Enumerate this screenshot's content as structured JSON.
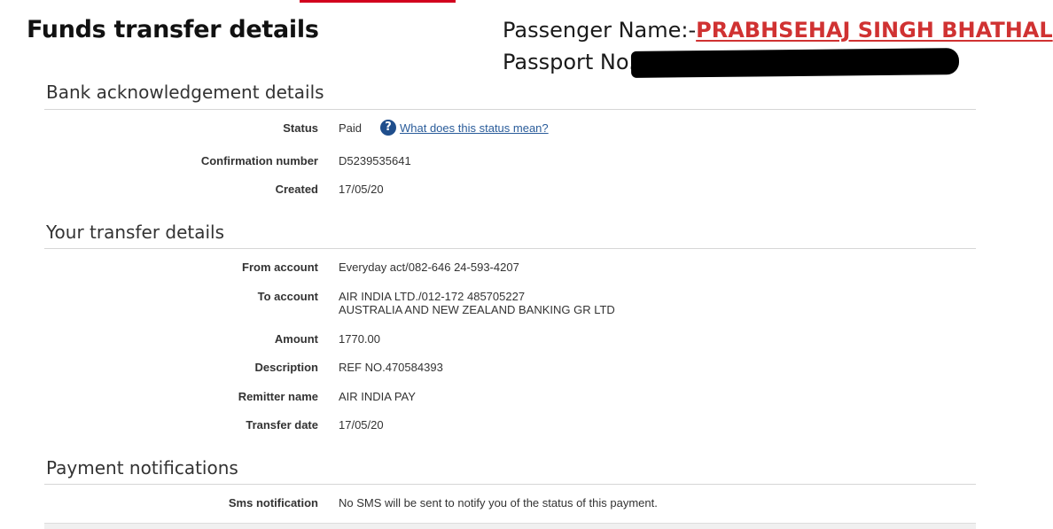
{
  "header": {
    "title": "Funds transfer details",
    "passenger_label": "Passenger Name:-",
    "passenger_name": "PRABHSEHAJ SINGH BHATHAL",
    "passport_label": "Passport No."
  },
  "bank_acknowledgement": {
    "heading": "Bank acknowledgement details",
    "status_label": "Status",
    "status_value": "Paid",
    "status_help_link": "What does this status mean?",
    "confirmation_label": "Confirmation number",
    "confirmation_value": "D5239535641",
    "created_label": "Created",
    "created_value": "17/05/20"
  },
  "transfer_details": {
    "heading": "Your transfer details",
    "from_label": "From account",
    "from_value": "Everyday act/082-646 24-593-4207",
    "to_label": "To account",
    "to_value_line1": "AIR INDIA LTD./012-172 485705227",
    "to_value_line2": "AUSTRALIA AND NEW ZEALAND BANKING GR LTD",
    "amount_label": "Amount",
    "amount_value": "1770.00",
    "description_label": "Description",
    "description_value": "REF NO.470584393",
    "remitter_label": "Remitter name",
    "remitter_value": "AIR INDIA PAY",
    "transfer_date_label": "Transfer date",
    "transfer_date_value": "17/05/20"
  },
  "payment_notifications": {
    "heading": "Payment notifications",
    "sms_label": "Sms notification",
    "sms_value": "No SMS will be sent to notify you of the status of this payment."
  },
  "colors": {
    "accent": "#d2001e",
    "passenger_name": "#d03232",
    "link": "#2a5c9a",
    "help_icon": "#1f4e8c"
  },
  "icons": {
    "help": "question-mark-circle-icon"
  }
}
